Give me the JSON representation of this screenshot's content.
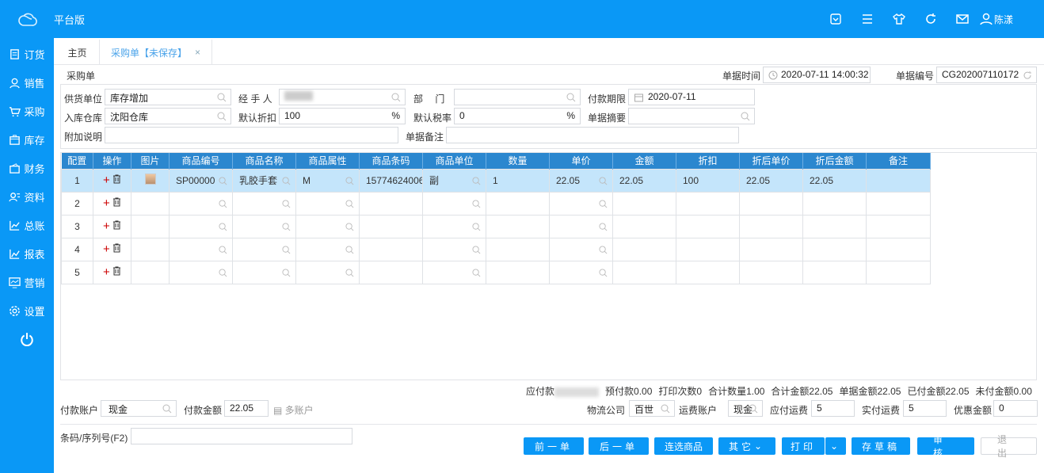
{
  "app": {
    "title": "平台版",
    "user": "陈漾"
  },
  "topbar_icons": [
    "dropdown-box-icon",
    "menu-icon",
    "shirt-icon",
    "refresh-icon",
    "mail-icon",
    "user-icon"
  ],
  "sidebar": {
    "items": [
      {
        "label": "订货",
        "icon": "clipboard-icon"
      },
      {
        "label": "销售",
        "icon": "person-icon"
      },
      {
        "label": "采购",
        "icon": "cart-icon"
      },
      {
        "label": "库存",
        "icon": "box-icon"
      },
      {
        "label": "财务",
        "icon": "wallet-icon"
      },
      {
        "label": "资料",
        "icon": "contacts-icon"
      },
      {
        "label": "总账",
        "icon": "chart-icon"
      },
      {
        "label": "报表",
        "icon": "report-icon"
      },
      {
        "label": "营销",
        "icon": "monitor-icon"
      },
      {
        "label": "设置",
        "icon": "gear-icon"
      }
    ]
  },
  "tabs": [
    {
      "label": "主页"
    },
    {
      "label": "采购单【未保存】"
    }
  ],
  "form": {
    "title": "采购单",
    "doc_time_label": "单据时间",
    "doc_time": "2020-07-11 14:00:32",
    "doc_no_label": "单据编号",
    "doc_no": "CG202007110172",
    "supplier_label": "供货单位",
    "supplier": "库存增加",
    "handler_label": "经 手 人",
    "dept_label": "部　 门",
    "dept": "",
    "pay_due_label": "付款期限",
    "pay_due": "2020-07-11",
    "warehouse_label": "入库仓库",
    "warehouse": "沈阳仓库",
    "discount_label": "默认折扣",
    "discount": "100",
    "pct": "%",
    "tax_label": "默认税率",
    "tax": "0",
    "summary_label": "单据摘要",
    "summary": "",
    "note_label": "附加说明",
    "note": "",
    "remark_label": "单据备注",
    "remark": ""
  },
  "table": {
    "headers": [
      "配置",
      "操作",
      "图片",
      "商品编号",
      "商品名称",
      "商品属性",
      "商品条码",
      "商品单位",
      "数量",
      "单价",
      "金额",
      "折扣",
      "折后单价",
      "折后金额",
      "备注"
    ],
    "rows": [
      {
        "no": "1",
        "code": "SP00000",
        "name": "乳胶手套",
        "attr": "M",
        "barcode": "15774624006",
        "unit": "副",
        "qty": "1",
        "price": "22.05",
        "amount": "22.05",
        "disc": "100",
        "dprice": "22.05",
        "damount": "22.05",
        "remark": ""
      },
      {
        "no": "2"
      },
      {
        "no": "3"
      },
      {
        "no": "4"
      },
      {
        "no": "5"
      }
    ]
  },
  "totals": {
    "payable_label": "应付款",
    "prepaid": "预付款0.00",
    "print_count": "打印次数0",
    "total_qty": "合计数量1.00",
    "total_amount": "合计金额22.05",
    "doc_amount": "单据金额22.05",
    "paid": "已付金额22.05",
    "unpaid": "未付金额0.00"
  },
  "logistics": {
    "company_label": "物流公司",
    "company": "百世",
    "freight_account_label": "运费账户",
    "freight_account": "现金",
    "freight_due_label": "应付运费",
    "freight_due": "5",
    "freight_paid_label": "实付运费",
    "freight_paid": "5",
    "discount_label": "优惠金额",
    "discount": "0"
  },
  "payment": {
    "account_label": "付款账户",
    "account": "现金",
    "amount_label": "付款金额",
    "amount": "22.05",
    "multi_label": "多账户"
  },
  "barcode": {
    "label": "条码/序列号(F2)",
    "value": ""
  },
  "buttons": {
    "prev": "前一单",
    "next": "后一单",
    "multi_select": "连选商品",
    "other": "其它",
    "print": "打印",
    "draft": "存草稿",
    "audit": "审核",
    "exit": "退出"
  }
}
